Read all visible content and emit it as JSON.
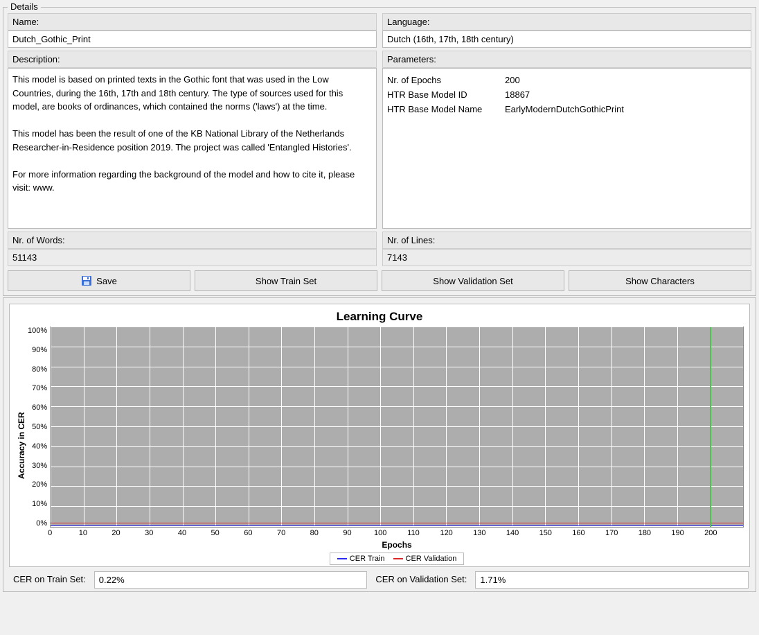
{
  "panel": {
    "title": "Details"
  },
  "fields": {
    "name_label": "Name:",
    "name_value": "Dutch_Gothic_Print",
    "language_label": "Language:",
    "language_value": "Dutch (16th, 17th, 18th century)",
    "description_label": "Description:",
    "description_value": "This model is based on printed texts in the Gothic font that was used in the Low Countries, during the 16th, 17th and 18th century. The type of sources used for this model, are books of ordinances, which contained the norms ('laws') at the time.\n\nThis model has been the result of one of the KB National Library of the Netherlands Researcher-in-Residence position 2019. The project was called 'Entangled Histories'.\n\nFor more information regarding the background of the model and how to cite it, please visit: www.",
    "parameters_label": "Parameters:",
    "parameters": [
      {
        "key": "Nr. of Epochs",
        "value": "200"
      },
      {
        "key": "HTR Base Model ID",
        "value": "18867"
      },
      {
        "key": "HTR Base Model Name",
        "value": "EarlyModernDutchGothicPrint"
      }
    ],
    "nr_words_label": "Nr. of Words:",
    "nr_words_value": "51143",
    "nr_lines_label": "Nr. of Lines:",
    "nr_lines_value": "7143"
  },
  "buttons": {
    "save": "Save",
    "show_train": "Show Train Set",
    "show_val": "Show Validation Set",
    "show_chars": "Show Characters"
  },
  "chart_data": {
    "type": "line",
    "title": "Learning Curve",
    "xlabel": "Epochs",
    "ylabel": "Accuracy in CER",
    "xlim": [
      0,
      210
    ],
    "ylim": [
      0,
      100
    ],
    "x_ticks": [
      0,
      10,
      20,
      30,
      40,
      50,
      60,
      70,
      80,
      90,
      100,
      110,
      120,
      130,
      140,
      150,
      160,
      170,
      180,
      190,
      200
    ],
    "y_ticks": [
      0,
      10,
      20,
      30,
      40,
      50,
      60,
      70,
      80,
      90,
      100
    ],
    "series": [
      {
        "name": "CER Train",
        "color": "#2a2af0",
        "final_value": 0.22
      },
      {
        "name": "CER Validation",
        "color": "#d92828",
        "final_value": 1.71
      }
    ],
    "marker_epoch": 200,
    "legend": [
      "CER Train",
      "CER Validation"
    ]
  },
  "cer": {
    "train_label": "CER on Train Set:",
    "train_value": "0.22%",
    "val_label": "CER on Validation Set:",
    "val_value": "1.71%"
  }
}
